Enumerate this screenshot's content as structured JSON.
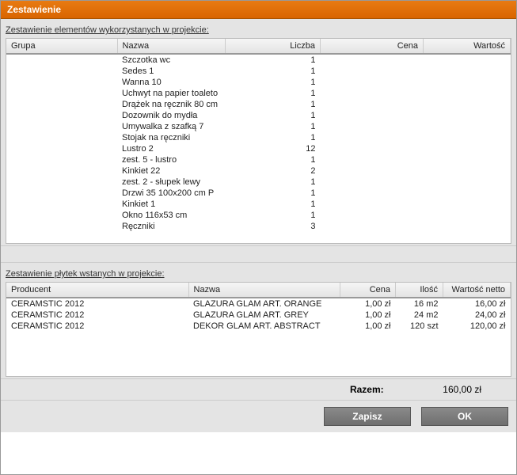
{
  "window": {
    "title": "Zestawienie"
  },
  "section1": {
    "title": "Zestawienie elementów wykorzystanych w projekcie:",
    "columns": {
      "grupa": "Grupa",
      "nazwa": "Nazwa",
      "liczba": "Liczba",
      "cena": "Cena",
      "wartosc": "Wartość"
    },
    "rows": [
      {
        "grupa": "",
        "nazwa": "Szczotka wc",
        "liczba": "1"
      },
      {
        "grupa": "",
        "nazwa": "Sedes 1",
        "liczba": "1"
      },
      {
        "grupa": "",
        "nazwa": "Wanna 10",
        "liczba": "1"
      },
      {
        "grupa": "",
        "nazwa": "Uchwyt na papier toaleto",
        "liczba": "1"
      },
      {
        "grupa": "",
        "nazwa": "Drążek na ręcznik 80 cm",
        "liczba": "1"
      },
      {
        "grupa": "",
        "nazwa": "Dozownik do mydła",
        "liczba": "1"
      },
      {
        "grupa": "",
        "nazwa": "Umywalka z szafką 7",
        "liczba": "1"
      },
      {
        "grupa": "",
        "nazwa": "Stojak na ręczniki",
        "liczba": "1"
      },
      {
        "grupa": "",
        "nazwa": "Lustro 2",
        "liczba": "12"
      },
      {
        "grupa": "",
        "nazwa": "zest. 5 - lustro",
        "liczba": "1"
      },
      {
        "grupa": "",
        "nazwa": " Kinkiet 22",
        "liczba": "2"
      },
      {
        "grupa": "",
        "nazwa": "zest. 2 - słupek lewy",
        "liczba": "1"
      },
      {
        "grupa": "",
        "nazwa": "Drzwi 35 100x200 cm P",
        "liczba": "1"
      },
      {
        "grupa": "",
        "nazwa": " Kinkiet 1",
        "liczba": "1"
      },
      {
        "grupa": "",
        "nazwa": " Okno 116x53 cm",
        "liczba": "1"
      },
      {
        "grupa": "",
        "nazwa": "Ręczniki",
        "liczba": "3"
      }
    ]
  },
  "section2": {
    "title": "Zestawienie płytek wstanych w projekcie:",
    "columns": {
      "producent": "Producent",
      "nazwa": "Nazwa",
      "cena": "Cena",
      "ilosc": "Ilość",
      "wartosc_netto": "Wartość netto"
    },
    "rows": [
      {
        "producent": "CERAMSTIC 2012",
        "nazwa": "GLAZURA GLAM ART. ORANGE",
        "cena": "1,00 zł",
        "ilosc": "16 m2",
        "wn": "16,00 zł"
      },
      {
        "producent": "CERAMSTIC 2012",
        "nazwa": "GLAZURA GLAM ART. GREY",
        "cena": "1,00 zł",
        "ilosc": "24 m2",
        "wn": "24,00 zł"
      },
      {
        "producent": "CERAMSTIC 2012",
        "nazwa": "DEKOR GLAM ART. ABSTRACT",
        "cena": "1,00 zł",
        "ilosc": "120 szt",
        "wn": "120,00 zł"
      }
    ]
  },
  "summary": {
    "label": "Razem:",
    "value": "160,00 zł"
  },
  "buttons": {
    "save": "Zapisz",
    "ok": "OK"
  }
}
